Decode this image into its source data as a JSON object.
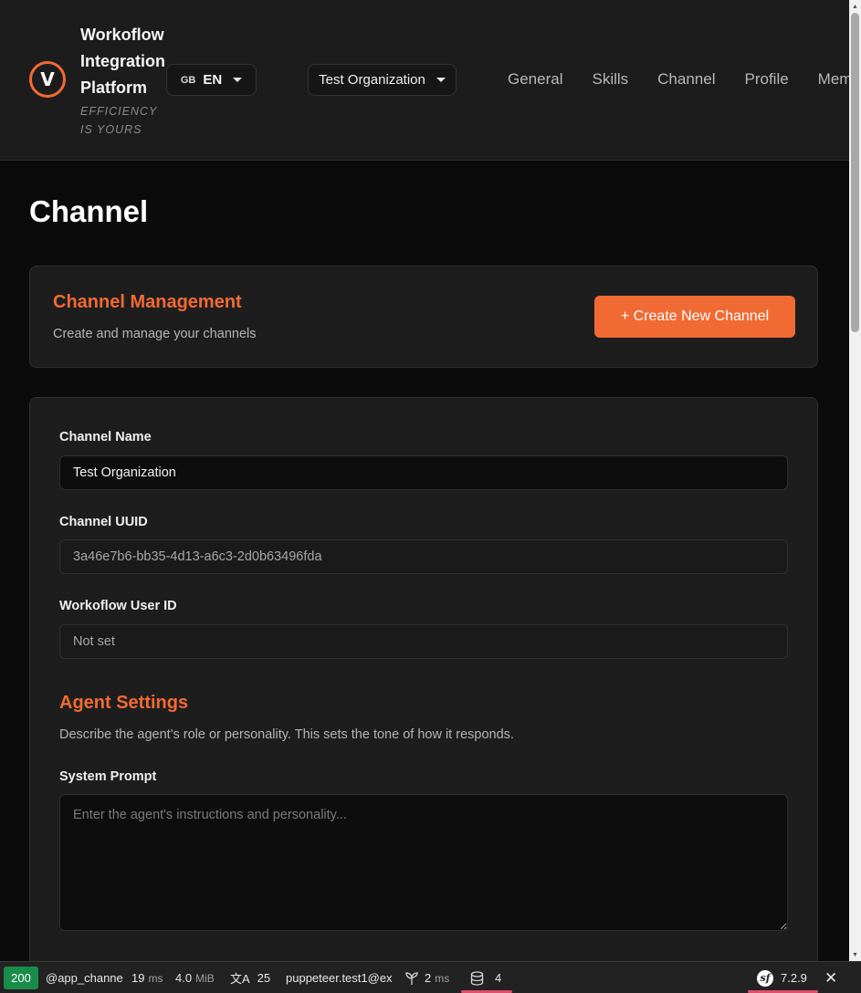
{
  "header": {
    "logo_letter": "V",
    "brand_title": "Workoflow Integration Platform",
    "tagline": "EFFICIENCY IS YOURS",
    "language": {
      "flag": "GB",
      "code": "EN"
    },
    "organization": "Test Organization",
    "nav": [
      "General",
      "Skills",
      "Channel",
      "Profile",
      "Mem"
    ]
  },
  "page_title": "Channel",
  "management": {
    "title": "Channel Management",
    "subtitle": "Create and manage your channels",
    "create_button": "+ Create New Channel"
  },
  "form": {
    "channel_name": {
      "label": "Channel Name",
      "value": "Test Organization"
    },
    "channel_uuid": {
      "label": "Channel UUID",
      "value": "3a46e7b6-bb35-4d13-a6c3-2d0b63496fda"
    },
    "user_id": {
      "label": "Workoflow User ID",
      "value": "Not set"
    },
    "agent_settings": {
      "title": "Agent Settings",
      "description": "Describe the agent's role or personality. This sets the tone of how it responds.",
      "system_prompt_label": "System Prompt",
      "system_prompt_placeholder": "Enter the agent's instructions and personality...",
      "system_prompt_value": ""
    }
  },
  "toolbar": {
    "status": "200",
    "route": "@app_channe",
    "time": "19",
    "time_unit": "ms",
    "memory": "4.0",
    "memory_unit": "MiB",
    "translations": "25",
    "user": "puppeteer.test1@ex",
    "twig_time": "2",
    "twig_unit": "ms",
    "db_queries": "4",
    "symfony_version": "7.2.9"
  },
  "colors": {
    "accent": "#f26a33",
    "background": "#0b0b0b",
    "card": "#1d1d1d",
    "status_ok": "#1a8c4a"
  }
}
